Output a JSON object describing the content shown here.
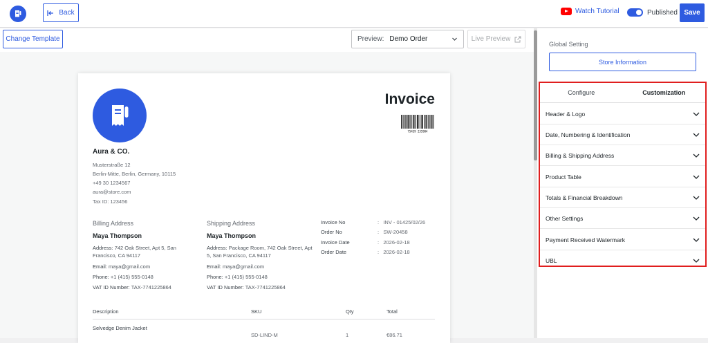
{
  "topbar": {
    "back_label": "Back",
    "watch_label": "Watch Tutorial",
    "published_label": "Published",
    "save_label": "Save"
  },
  "toolbar": {
    "change_template_label": "Change Template",
    "preview_prefix": "Preview:",
    "preview_value": "Demo Order",
    "live_preview_label": "Live Preview"
  },
  "invoice": {
    "title": "Invoice",
    "barcode_text": "75439 235904",
    "company": "Aura & CO.",
    "address_lines": [
      "Musterstraße 12",
      "Berlin-Mitte, Berlin, Germany, 10115",
      "+49 30 1234567",
      "aura@store.com",
      "Tax ID: 123456"
    ],
    "billing": {
      "heading": "Billing Address",
      "name": "Maya Thompson",
      "address_label": "Address:",
      "address": "742 Oak Street, Apt 5, San Francisco, CA 94117",
      "email_label": "Email:",
      "email": "maya@gmail.com",
      "phone_label": "Phone:",
      "phone": "+1 (415) 555-0148",
      "vat_label": "VAT ID Number:",
      "vat": "TAX-7741225864"
    },
    "shipping": {
      "heading": "Shipping Address",
      "name": "Maya Thompson",
      "address_label": "Address:",
      "address": "Package Room, 742 Oak Street, Apt 5, San Francisco, CA 94117",
      "email_label": "Email:",
      "email": "maya@gmail.com",
      "phone_label": "Phone:",
      "phone": "+1 (415) 555-0148",
      "vat_label": "VAT ID Number:",
      "vat": "TAX-7741225864"
    },
    "meta": [
      {
        "label": "Invoice No",
        "value": "INV - 01425/02/26"
      },
      {
        "label": "Order No",
        "value": "SW-20458"
      },
      {
        "label": "Invoice Date",
        "value": "2026-02-18"
      },
      {
        "label": "Order Date",
        "value": "2026-02-18"
      }
    ],
    "table": {
      "headers": [
        "Description",
        "SKU",
        "Qty",
        "Total"
      ],
      "rows": [
        {
          "description": "Selvedge Denim Jacket",
          "sku": "SD-LIND-M",
          "qty": "1",
          "total": "€86.71"
        }
      ]
    }
  },
  "sidebar": {
    "global_setting_label": "Global Setting",
    "store_info_label": "Store Information",
    "tabs": [
      "Configure",
      "Customization"
    ],
    "active_tab": "Customization",
    "accordion": [
      "Header & Logo",
      "Date, Numbering & Identification",
      "Billing & Shipping Address",
      "Product Table",
      "Totals & Financial Breakdown",
      "Other Settings",
      "Payment Received Watermark",
      "UBL"
    ]
  },
  "colors": {
    "accent": "#2e5be0",
    "highlight_border": "#e01e1e",
    "youtube": "#ff0000"
  }
}
